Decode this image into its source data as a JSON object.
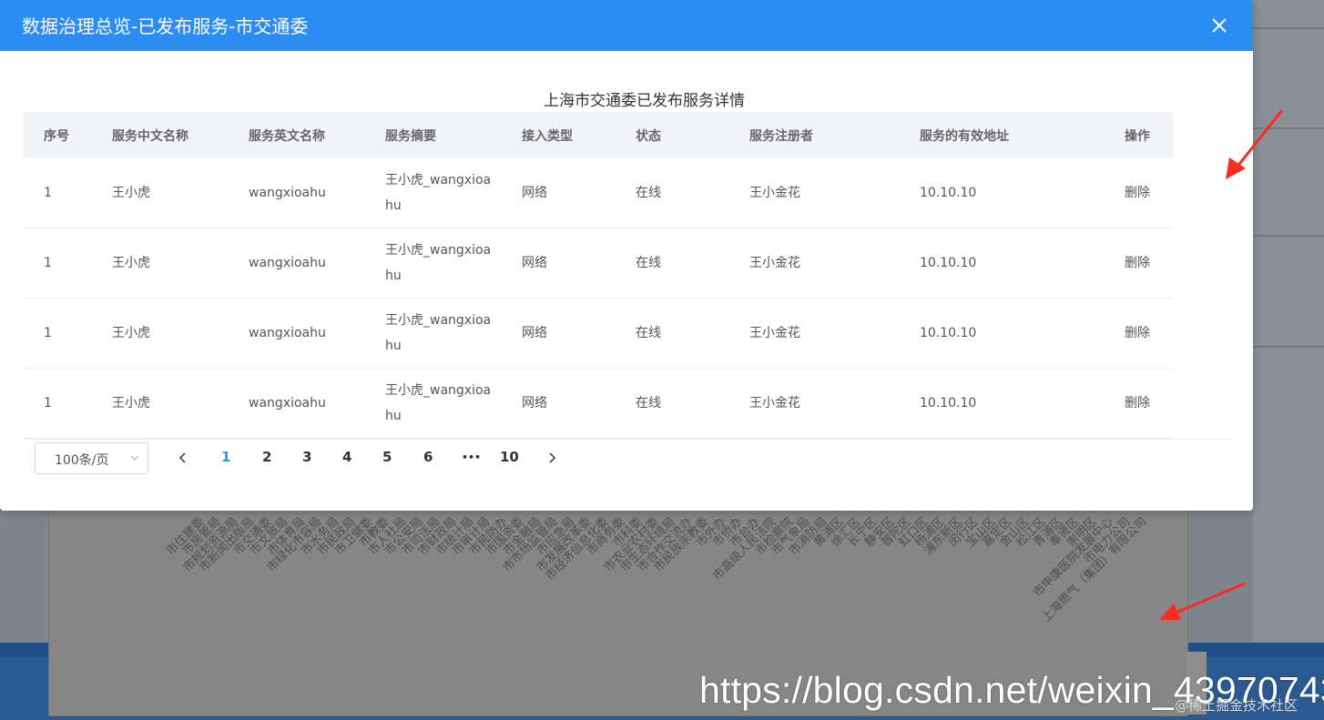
{
  "modal": {
    "title": "数据治理总览-已发布服务-市交通委",
    "close_icon": "close-icon",
    "caption": "上海市交通委已发布服务详情"
  },
  "table": {
    "headers": [
      "序号",
      "服务中文名称",
      "服务英文名称",
      "服务摘要",
      "接入类型",
      "状态",
      "服务注册者",
      "服务的有效地址",
      "操作"
    ],
    "rows": [
      {
        "idx": "1",
        "cn_name": "王小虎",
        "en_name": "wangxioahu",
        "summary": "王小虎_wangxioahu",
        "type": "网络",
        "status": "在线",
        "registrant": "王小金花",
        "address": "10.10.10",
        "action": "删除"
      },
      {
        "idx": "1",
        "cn_name": "王小虎",
        "en_name": "wangxioahu",
        "summary": "王小虎_wangxioahu",
        "type": "网络",
        "status": "在线",
        "registrant": "王小金花",
        "address": "10.10.10",
        "action": "删除"
      },
      {
        "idx": "1",
        "cn_name": "王小虎",
        "en_name": "wangxioahu",
        "summary": "王小虎_wangxioahu",
        "type": "网络",
        "status": "在线",
        "registrant": "王小金花",
        "address": "10.10.10",
        "action": "删除"
      },
      {
        "idx": "1",
        "cn_name": "王小虎",
        "en_name": "wangxioahu",
        "summary": "王小虎_wangxioahu",
        "type": "网络",
        "status": "在线",
        "registrant": "王小金花",
        "address": "10.10.10",
        "action": "删除"
      }
    ]
  },
  "pagination": {
    "page_size": "100条/页",
    "pages": [
      "1",
      "2",
      "3",
      "4",
      "5",
      "6",
      "•••",
      "10"
    ],
    "current": "1"
  },
  "background_chart": {
    "labels": [
      "市住建委",
      "市房管局",
      "市规划资源局",
      "市新闻出版局",
      "市交通委",
      "市文旅局",
      "市体育局",
      "市绿化市容局",
      "市水务局",
      "市民政局",
      "市卫健委",
      "市教委",
      "市人社局",
      "市公安局",
      "市司法局",
      "市财政局",
      "市统计局",
      "市审计局",
      "市民防办",
      "市国资委",
      "市金融局",
      "市市场监管局",
      "市应急局",
      "市发展改革委",
      "市经济信息化委",
      "市商务委",
      "市科委",
      "市农业农村委",
      "市生态环境局",
      "市合作交流办",
      "市民族宗教委",
      "市外办",
      "市侨办",
      "市台办",
      "市高级人民法院",
      "市检察院",
      "市气象局",
      "市消防局",
      "黄浦区",
      "徐汇区",
      "长宁区",
      "静安区",
      "普陀区",
      "虹口区",
      "杨浦区",
      "浦东新区",
      "闵行区",
      "宝山区",
      "嘉定区",
      "金山区",
      "松江区",
      "青浦区",
      "奉贤区",
      "崇明区",
      "市申康医院发展中心",
      "市电力公司",
      "上海燃气（集团）有限公司"
    ]
  },
  "watermark": {
    "url": "https://blog.csdn.net/weixin_43970743",
    "credit": "@稀土掘金技术社区"
  },
  "colors": {
    "header_blue": "#2b8cf4",
    "active_page": "#1e9be8",
    "annotation_red": "#ff2a1f"
  }
}
